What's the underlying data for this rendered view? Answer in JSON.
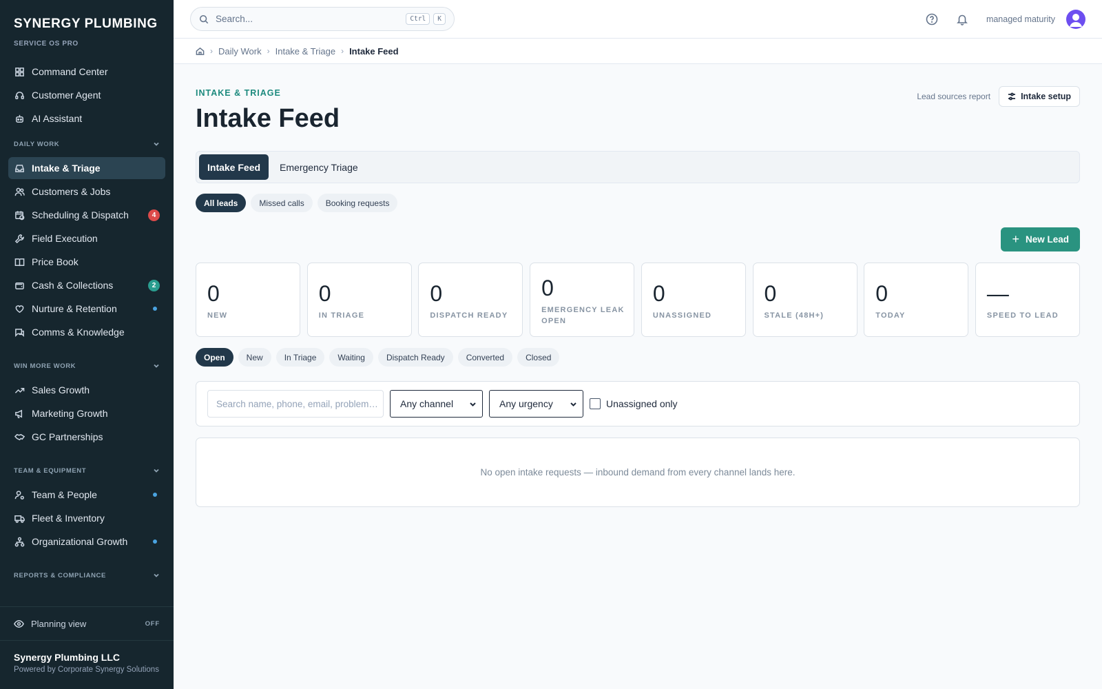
{
  "brand": {
    "name": "SYNERGY PLUMBING ...",
    "sub": "SERVICE OS PRO"
  },
  "nav": {
    "top": [
      {
        "label": "Command Center",
        "icon": "grid-icon"
      },
      {
        "label": "Customer Agent",
        "icon": "headset-icon"
      },
      {
        "label": "AI Assistant",
        "icon": "robot-icon"
      }
    ],
    "sections": {
      "daily_work": "DAILY WORK",
      "win_more_work": "WIN MORE WORK",
      "team_equipment": "TEAM & EQUIPMENT",
      "reports_compliance": "REPORTS & COMPLIANCE"
    },
    "daily": [
      {
        "label": "Intake & Triage",
        "icon": "inbox-icon",
        "active": true
      },
      {
        "label": "Customers & Jobs",
        "icon": "users-icon"
      },
      {
        "label": "Scheduling & Dispatch",
        "icon": "calendar-clock-icon",
        "badge": "4"
      },
      {
        "label": "Field Execution",
        "icon": "wrench-icon"
      },
      {
        "label": "Price Book",
        "icon": "book-icon"
      },
      {
        "label": "Cash & Collections",
        "icon": "wallet-icon",
        "badge": "2"
      },
      {
        "label": "Nurture & Retention",
        "icon": "heart-hand-icon"
      },
      {
        "label": "Comms & Knowledge",
        "icon": "chat-icon"
      }
    ],
    "win": [
      {
        "label": "Sales Growth",
        "icon": "trending-up-icon"
      },
      {
        "label": "Marketing Growth",
        "icon": "megaphone-icon"
      },
      {
        "label": "GC Partnerships",
        "icon": "handshake-icon"
      }
    ],
    "team": [
      {
        "label": "Team & People",
        "icon": "user-gear-icon"
      },
      {
        "label": "Fleet & Inventory",
        "icon": "truck-icon"
      },
      {
        "label": "Organizational Growth",
        "icon": "org-chart-icon"
      }
    ]
  },
  "planning": {
    "label": "Planning view",
    "state": "OFF"
  },
  "company": {
    "name": "Synergy Plumbing LLC",
    "sub": "Powered by Corporate Synergy Solutions"
  },
  "topbar": {
    "search_placeholder": "Search...",
    "kbd1": "Ctrl",
    "kbd2": "K",
    "user": "managed maturity"
  },
  "breadcrumb": [
    "Daily Work",
    "Intake & Triage",
    "Intake Feed"
  ],
  "page": {
    "eyebrow": "INTAKE & TRIAGE",
    "title": "Intake Feed",
    "lead_sources": "Lead sources report",
    "setup": "Intake setup"
  },
  "tabs": [
    "Intake Feed",
    "Emergency Triage"
  ],
  "lead_pills": [
    "All leads",
    "Missed calls",
    "Booking requests"
  ],
  "new_lead": "New Lead",
  "stats": [
    {
      "value": "0",
      "label": "NEW"
    },
    {
      "value": "0",
      "label": "IN TRIAGE"
    },
    {
      "value": "0",
      "label": "DISPATCH READY"
    },
    {
      "value": "0",
      "label": "EMERGENCY LEAK OPEN"
    },
    {
      "value": "0",
      "label": "UNASSIGNED"
    },
    {
      "value": "0",
      "label": "STALE (48H+)"
    },
    {
      "value": "0",
      "label": "TODAY"
    },
    {
      "value": "—",
      "label": "SPEED TO LEAD"
    }
  ],
  "status_pills": [
    "Open",
    "New",
    "In Triage",
    "Waiting",
    "Dispatch Ready",
    "Converted",
    "Closed"
  ],
  "filters": {
    "search_placeholder": "Search name, phone, email, problem…",
    "channel": "Any channel",
    "urgency": "Any urgency",
    "unassigned": "Unassigned only"
  },
  "empty": "No open intake requests — inbound demand from every channel lands here.",
  "colors": {
    "sidebar": "#16262e",
    "accent": "#2a9380",
    "active_tab": "#22384a"
  }
}
